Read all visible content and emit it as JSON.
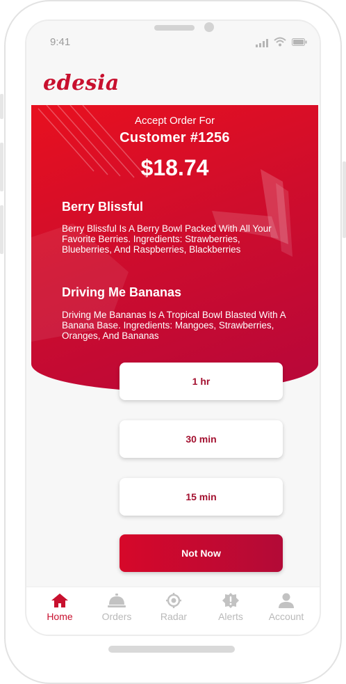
{
  "status_bar": {
    "time": "9:41"
  },
  "app": {
    "logo": "edesia",
    "brand_color": "#c8102e"
  },
  "order": {
    "accept_text": "Accept Order For",
    "customer": "Customer #1256",
    "price": "$18.74",
    "items": [
      {
        "name": "Berry Blissful",
        "description": "Berry Blissful  Is A Berry Bowl Packed With All Your Favorite Berries. Ingredients: Strawberries, Blueberries, And Raspberries, Blackberries"
      },
      {
        "name": "Driving Me Bananas",
        "description": "Driving Me Bananas Is A Tropical Bowl Blasted With A Banana Base. Ingredients: Mangoes, Strawberries, Oranges, And Bananas"
      }
    ]
  },
  "time_options": [
    "1 hr",
    "30 min",
    "15 min"
  ],
  "decline_label": "Not Now",
  "tabs": [
    {
      "label": "Home",
      "icon": "home-icon",
      "active": true
    },
    {
      "label": "Orders",
      "icon": "cloche-icon",
      "active": false
    },
    {
      "label": "Radar",
      "icon": "radar-icon",
      "active": false
    },
    {
      "label": "Alerts",
      "icon": "alert-icon",
      "active": false
    },
    {
      "label": "Account",
      "icon": "user-icon",
      "active": false
    }
  ],
  "colors": {
    "hero_start": "#e8101f",
    "hero_end": "#b7073a",
    "inactive_tab": "#b9b9b9"
  }
}
